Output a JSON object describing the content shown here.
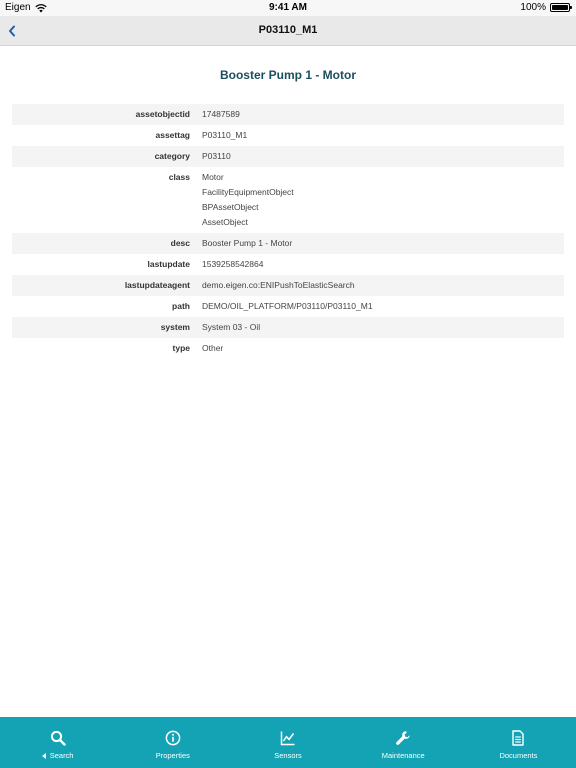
{
  "status_bar": {
    "carrier": "Eigen",
    "time": "9:41 AM",
    "battery": "100%"
  },
  "nav": {
    "title": "P03110_M1"
  },
  "heading": "Booster Pump 1 - Motor",
  "properties": [
    {
      "key": "assetobjectid",
      "values": [
        "17487589"
      ]
    },
    {
      "key": "assettag",
      "values": [
        "P03110_M1"
      ]
    },
    {
      "key": "category",
      "values": [
        "P03110"
      ]
    },
    {
      "key": "class",
      "values": [
        "Motor",
        "FacilityEquipmentObject",
        "BPAssetObject",
        "AssetObject"
      ]
    },
    {
      "key": "desc",
      "values": [
        "Booster Pump 1 - Motor"
      ]
    },
    {
      "key": "lastupdate",
      "values": [
        "1539258542864"
      ]
    },
    {
      "key": "lastupdateagent",
      "values": [
        "demo.eigen.co:ENIPushToElasticSearch"
      ]
    },
    {
      "key": "path",
      "values": [
        "DEMO/OIL_PLATFORM/P03110/P03110_M1"
      ]
    },
    {
      "key": "system",
      "values": [
        "System 03 - Oil"
      ]
    },
    {
      "key": "type",
      "values": [
        "Other"
      ]
    }
  ],
  "tabs": {
    "search": "Search",
    "properties": "Properties",
    "sensors": "Sensors",
    "maintenance": "Maintenance",
    "documents": "Documents"
  },
  "colors": {
    "tab_bar": "#13a3b4",
    "heading": "#1c4e5e",
    "back_chevron": "#1a5fb4"
  }
}
